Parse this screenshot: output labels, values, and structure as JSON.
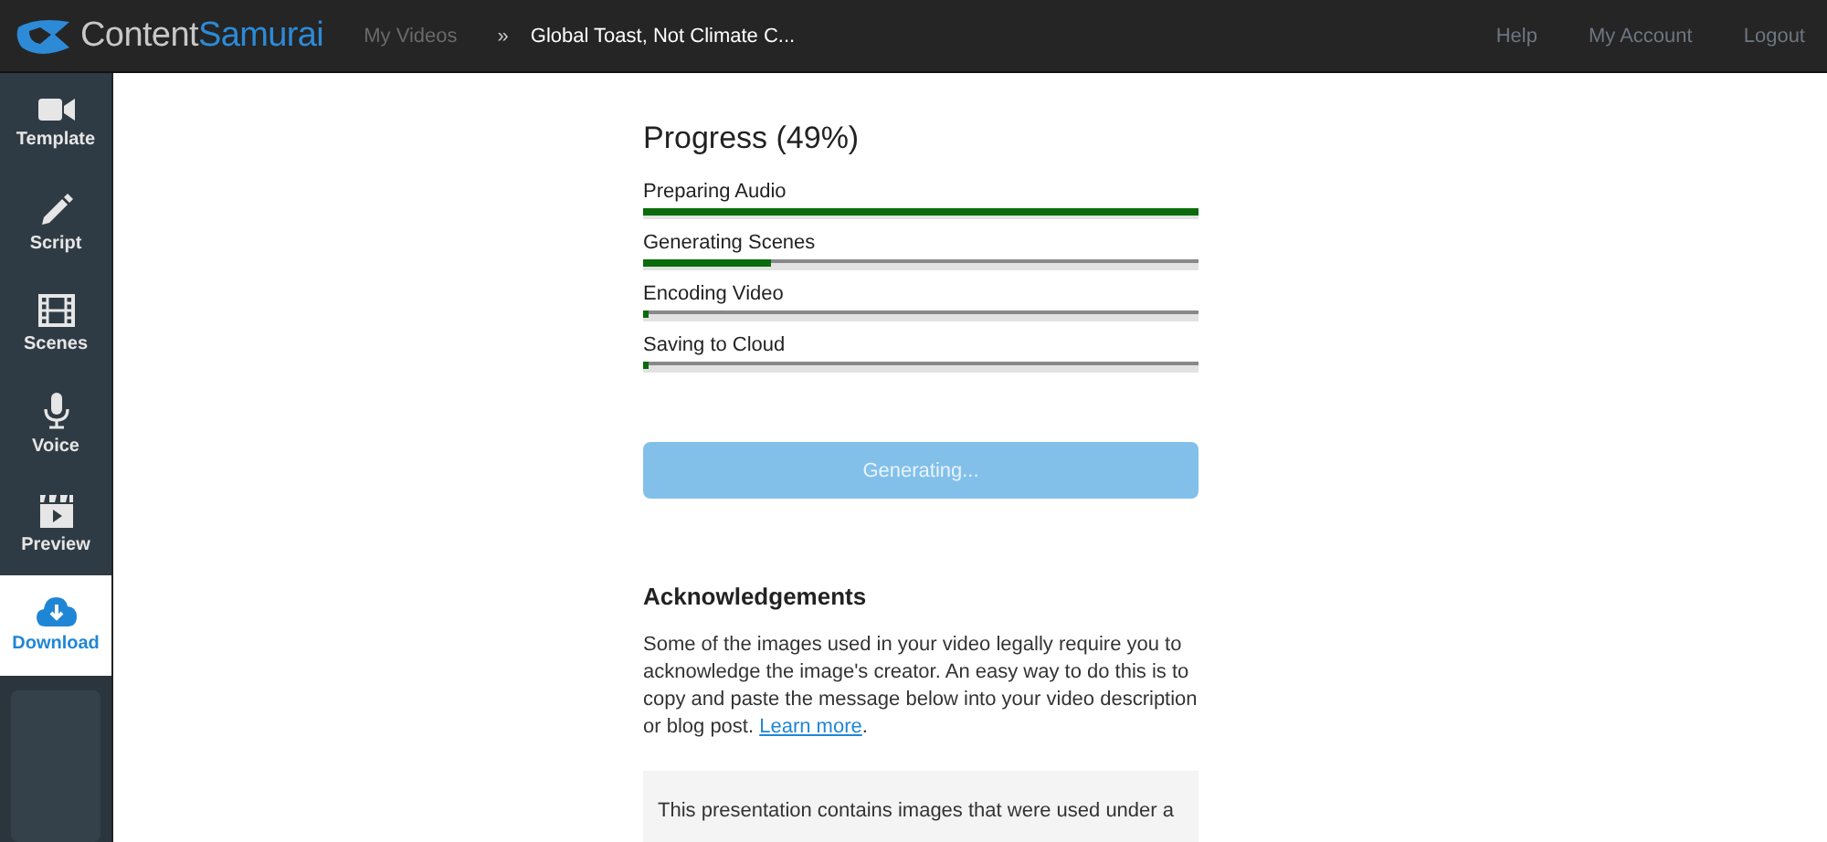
{
  "header": {
    "logo": {
      "text_1": "Content",
      "text_2": "Samurai"
    },
    "breadcrumbs": [
      {
        "label": "My Videos",
        "current": false
      },
      {
        "label": "Global Toast, Not Climate C...",
        "current": true
      }
    ],
    "separator": "»",
    "nav": [
      "Help",
      "My Account",
      "Logout"
    ]
  },
  "sidebar": {
    "items": [
      {
        "label": "Template",
        "kind": "template",
        "selected": false
      },
      {
        "label": "Script",
        "kind": "script",
        "selected": false
      },
      {
        "label": "Scenes",
        "kind": "scenes",
        "selected": false
      },
      {
        "label": "Voice",
        "kind": "voice",
        "selected": false
      },
      {
        "label": "Preview",
        "kind": "preview",
        "selected": false
      },
      {
        "label": "Download",
        "kind": "download",
        "selected": true
      }
    ]
  },
  "progress": {
    "title": "Progress (49%)",
    "steps": [
      {
        "label": "Preparing Audio",
        "level": 1
      },
      {
        "label": "Generating Scenes",
        "level": 0.23
      },
      {
        "label": "Encoding Video",
        "level": 0.01
      },
      {
        "label": "Saving to Cloud",
        "level": 0.01
      }
    ],
    "button": {
      "label": "Generating...",
      "disabled": true
    }
  },
  "acknowledgements": {
    "title": "Acknowledgements",
    "text_before": "Some of the images used in your video legally require you to acknowledge the image's creator. An easy way to do this is to copy and paste the message below into your video description or blog post. ",
    "link": "Learn more",
    "text_after": ".",
    "message": "This presentation contains images that were used under a"
  }
}
